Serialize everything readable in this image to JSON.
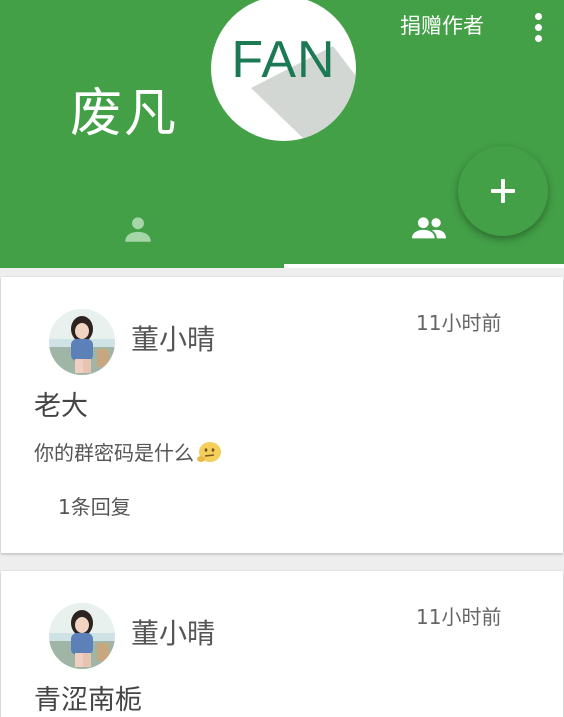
{
  "header": {
    "title": "废凡",
    "logo_text": "FAN",
    "donate_label": "捐赠作者",
    "accent_color": "#43a047"
  },
  "tabs": [
    {
      "icon": "person-icon",
      "selected": false
    },
    {
      "icon": "group-icon",
      "selected": true
    }
  ],
  "fab": {
    "icon": "plus-icon"
  },
  "posts": [
    {
      "author": "董小晴",
      "time": "11小时前",
      "title": "老大",
      "body": "你的群密码是什么",
      "body_emoji": "thinking-emoji-icon",
      "replies": "1条回复"
    },
    {
      "author": "董小晴",
      "time": "11小时前",
      "title": "青涩南栀"
    }
  ]
}
